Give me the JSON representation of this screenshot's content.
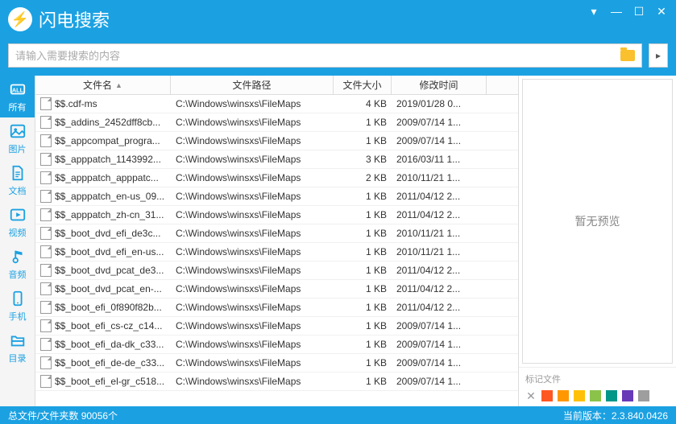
{
  "app": {
    "title": "闪电搜索"
  },
  "search": {
    "placeholder": "请输入需要搜索的内容"
  },
  "sidebar": {
    "items": [
      {
        "label": "所有",
        "key": "all"
      },
      {
        "label": "图片",
        "key": "image"
      },
      {
        "label": "文档",
        "key": "doc"
      },
      {
        "label": "视频",
        "key": "video"
      },
      {
        "label": "音频",
        "key": "audio"
      },
      {
        "label": "手机",
        "key": "phone"
      },
      {
        "label": "目录",
        "key": "folder"
      }
    ]
  },
  "columns": {
    "name": "文件名",
    "path": "文件路径",
    "size": "文件大小",
    "date": "修改时间"
  },
  "files": [
    {
      "name": "$$.cdf-ms",
      "path": "C:\\Windows\\winsxs\\FileMaps",
      "size": "4 KB",
      "date": "2019/01/28 0..."
    },
    {
      "name": "$$_addins_2452dff8cb...",
      "path": "C:\\Windows\\winsxs\\FileMaps",
      "size": "1 KB",
      "date": "2009/07/14 1..."
    },
    {
      "name": "$$_appcompat_progra...",
      "path": "C:\\Windows\\winsxs\\FileMaps",
      "size": "1 KB",
      "date": "2009/07/14 1..."
    },
    {
      "name": "$$_apppatch_1143992...",
      "path": "C:\\Windows\\winsxs\\FileMaps",
      "size": "3 KB",
      "date": "2016/03/11 1..."
    },
    {
      "name": "$$_apppatch_apppatc...",
      "path": "C:\\Windows\\winsxs\\FileMaps",
      "size": "2 KB",
      "date": "2010/11/21 1..."
    },
    {
      "name": "$$_apppatch_en-us_09...",
      "path": "C:\\Windows\\winsxs\\FileMaps",
      "size": "1 KB",
      "date": "2011/04/12 2..."
    },
    {
      "name": "$$_apppatch_zh-cn_31...",
      "path": "C:\\Windows\\winsxs\\FileMaps",
      "size": "1 KB",
      "date": "2011/04/12 2..."
    },
    {
      "name": "$$_boot_dvd_efi_de3c...",
      "path": "C:\\Windows\\winsxs\\FileMaps",
      "size": "1 KB",
      "date": "2010/11/21 1..."
    },
    {
      "name": "$$_boot_dvd_efi_en-us...",
      "path": "C:\\Windows\\winsxs\\FileMaps",
      "size": "1 KB",
      "date": "2010/11/21 1..."
    },
    {
      "name": "$$_boot_dvd_pcat_de3...",
      "path": "C:\\Windows\\winsxs\\FileMaps",
      "size": "1 KB",
      "date": "2011/04/12 2..."
    },
    {
      "name": "$$_boot_dvd_pcat_en-...",
      "path": "C:\\Windows\\winsxs\\FileMaps",
      "size": "1 KB",
      "date": "2011/04/12 2..."
    },
    {
      "name": "$$_boot_efi_0f890f82b...",
      "path": "C:\\Windows\\winsxs\\FileMaps",
      "size": "1 KB",
      "date": "2011/04/12 2..."
    },
    {
      "name": "$$_boot_efi_cs-cz_c14...",
      "path": "C:\\Windows\\winsxs\\FileMaps",
      "size": "1 KB",
      "date": "2009/07/14 1..."
    },
    {
      "name": "$$_boot_efi_da-dk_c33...",
      "path": "C:\\Windows\\winsxs\\FileMaps",
      "size": "1 KB",
      "date": "2009/07/14 1..."
    },
    {
      "name": "$$_boot_efi_de-de_c33...",
      "path": "C:\\Windows\\winsxs\\FileMaps",
      "size": "1 KB",
      "date": "2009/07/14 1..."
    },
    {
      "name": "$$_boot_efi_el-gr_c518...",
      "path": "C:\\Windows\\winsxs\\FileMaps",
      "size": "1 KB",
      "date": "2009/07/14 1..."
    }
  ],
  "preview": {
    "empty": "暂无预览"
  },
  "tags": {
    "label": "标记文件",
    "colors": [
      "#ff5722",
      "#ff9800",
      "#ffc107",
      "#8bc34a",
      "#009688",
      "#673ab7",
      "#9e9e9e"
    ]
  },
  "status": {
    "left_label": "总文件/文件夹数",
    "count": "90056个",
    "right_label": "当前版本：",
    "version": "2.3.840.0426"
  }
}
